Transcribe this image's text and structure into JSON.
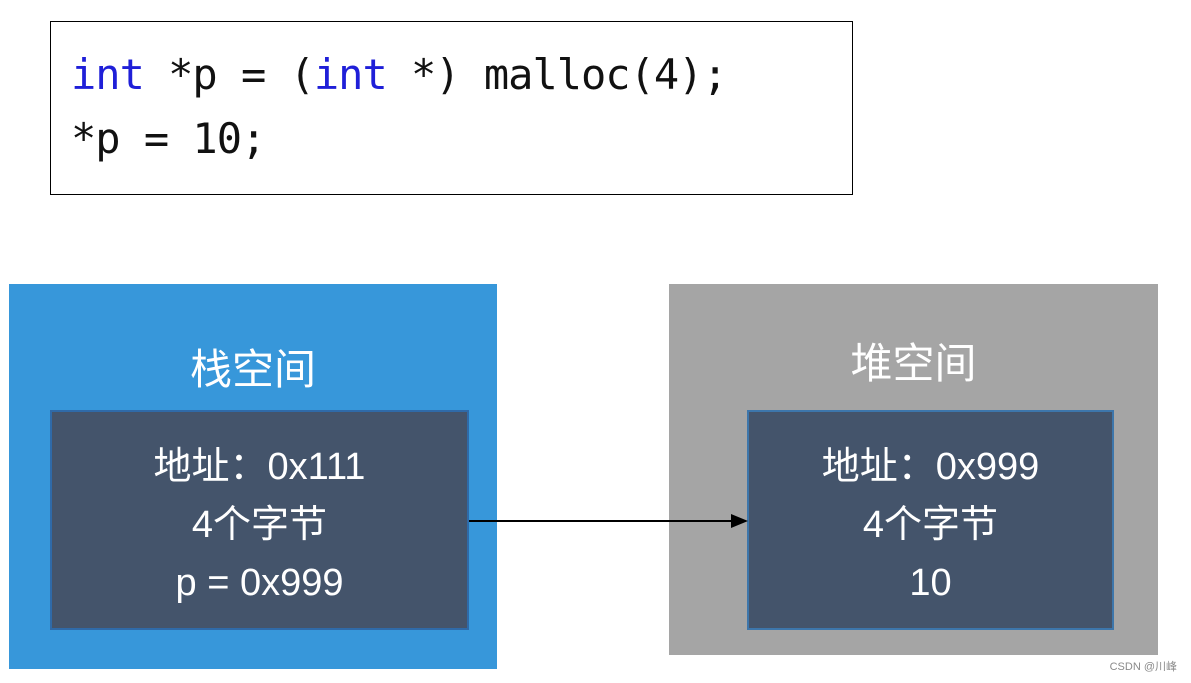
{
  "code": {
    "line1": [
      {
        "text": "int",
        "type": "keyword"
      },
      {
        "text": " *p = (",
        "type": "plain"
      },
      {
        "text": "int",
        "type": "keyword"
      },
      {
        "text": " *) malloc(4);",
        "type": "plain"
      }
    ],
    "line2": "*p = 10;"
  },
  "stack": {
    "title": "栈空间",
    "cell": {
      "address": "地址：0x111",
      "size": "4个字节",
      "value": "p = 0x999"
    }
  },
  "heap": {
    "title": "堆空间",
    "cell": {
      "address": "地址：0x999",
      "size": "4个字节",
      "value": "10"
    }
  },
  "arrow": {
    "from": "stack.cell",
    "to": "heap.cell",
    "label": ""
  },
  "colors": {
    "stack_bg": "#3797da",
    "heap_bg": "#a5a5a5",
    "cell_bg": "#44546b",
    "keyword": "#1f1fd8"
  },
  "watermark": "CSDN @川峰"
}
